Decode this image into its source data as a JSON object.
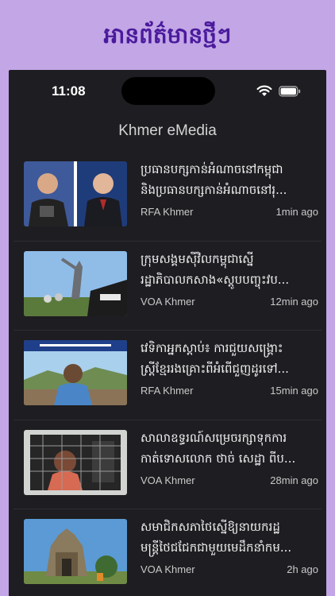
{
  "banner": {
    "title": "អានព័ត៌មានថ្មីៗ"
  },
  "status_bar": {
    "time": "11:08"
  },
  "app": {
    "title": "Khmer eMedia"
  },
  "articles": [
    {
      "line1": "ប្រធានបក្សកាន់អំណាចនៅកម្ពុជា",
      "line2": "និងប្រធានបក្សកាន់អំណាចនៅរុ...",
      "source": "RFA Khmer",
      "ago": "1min ago"
    },
    {
      "line1": "ក្រុមសង្គមស៊ីវិលកម្ពុជាស្នើ",
      "line2": "រដ្ឋាភិបាលកសាង«ស្តូបបញ្ចុះវប...",
      "source": "VOA Khmer",
      "ago": "12min ago"
    },
    {
      "line1": "វេទិកាអ្នកស្ដាប់៖ ការជួយសង្គ្រោះ",
      "line2": "ស្ត្រីខ្មែររងគ្រោះពីអំពើជួញដូរទៅ...",
      "source": "RFA Khmer",
      "ago": "15min ago"
    },
    {
      "line1": "សាលាឧទ្ធរណ៍សម្រេចរក្សាទុកការ",
      "line2": "កាត់ទោសលោក ថាច់ សេដ្ឋា ពីប...",
      "source": "VOA Khmer",
      "ago": "28min ago"
    },
    {
      "line1": "សមាជិកសភាថៃស្នើឱ្យនាយករដ្ឋ",
      "line2": "មន្ត្រីថៃជជែកជាមួយមេដឹកនាំកម...",
      "source": "VOA Khmer",
      "ago": "2h ago"
    }
  ]
}
